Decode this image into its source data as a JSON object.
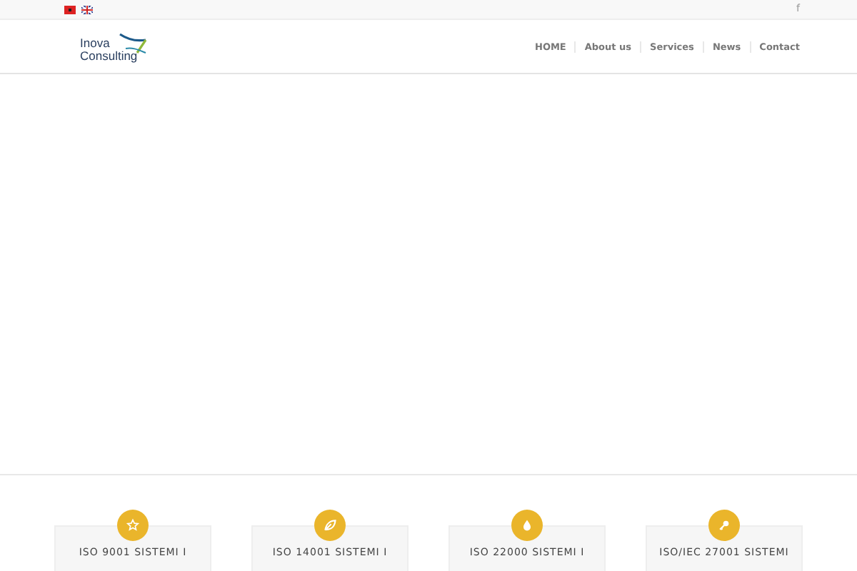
{
  "top_bar": {
    "languages": [
      {
        "kind": "albanian",
        "selected": false
      },
      {
        "kind": "english",
        "selected": false
      }
    ],
    "social": "f"
  },
  "header": {
    "logo": {
      "line_1": "Inova",
      "line_2": "Consulting"
    },
    "nav": [
      {
        "label": "HOME"
      },
      {
        "label": "About us"
      },
      {
        "label": "Services"
      },
      {
        "label": "News"
      },
      {
        "label": "Contact"
      }
    ]
  },
  "features": [
    {
      "kind": "star",
      "title": "ISO 9001 SISTEMI I"
    },
    {
      "kind": "leaf",
      "title": "ISO 14001 SISTEMI I"
    },
    {
      "kind": "drop",
      "title": "ISO 22000 SISTEMI I"
    },
    {
      "kind": "key",
      "title": "ISO/IEC 27001 SISTEMI"
    }
  ]
}
